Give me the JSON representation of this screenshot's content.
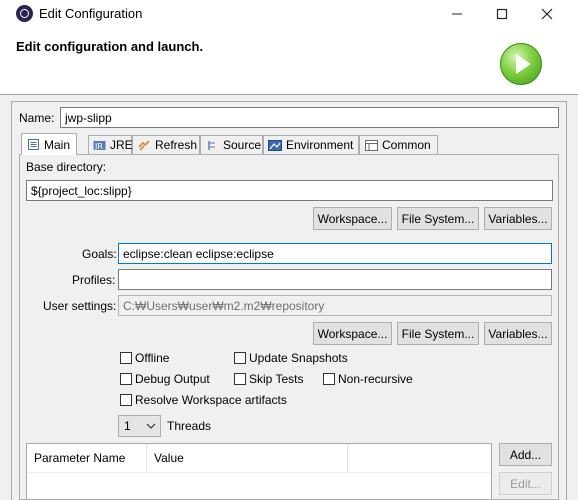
{
  "window": {
    "title": "Edit Configuration",
    "banner_title": "Edit configuration and launch."
  },
  "icons": {
    "app": "eclipse-icon",
    "run": "run-icon",
    "minimize": "minimize-icon",
    "maximize": "maximize-icon",
    "close": "close-icon"
  },
  "name": {
    "label": "Name:",
    "value": "jwp-slipp"
  },
  "tabs": [
    {
      "label": "Main",
      "icon": "main-tab-icon",
      "active": true
    },
    {
      "label": "JRE",
      "icon": "jre-icon"
    },
    {
      "label": "Refresh",
      "icon": "refresh-icon"
    },
    {
      "label": "Source",
      "icon": "source-icon"
    },
    {
      "label": "Environment",
      "icon": "environment-icon"
    },
    {
      "label": "Common",
      "icon": "common-icon"
    }
  ],
  "main": {
    "base_dir_label": "Base directory:",
    "base_dir_value": "${project_loc:slipp}",
    "buttons": {
      "workspace": "Workspace...",
      "file_system": "File System...",
      "variables": "Variables..."
    },
    "goals_label": "Goals:",
    "goals_value": "eclipse:clean eclipse:eclipse",
    "profiles_label": "Profiles:",
    "profiles_value": "",
    "user_settings_label": "User settings:",
    "user_settings_placeholder": "C:₩Users₩user₩m2.m2₩repository",
    "options": {
      "offline": "Offline",
      "update_snapshots": "Update Snapshots",
      "debug_output": "Debug Output",
      "skip_tests": "Skip Tests",
      "non_recursive": "Non-recursive",
      "resolve_workspace": "Resolve Workspace artifacts"
    },
    "threads_value": "1",
    "threads_label": "Threads",
    "table": {
      "columns": [
        "Parameter Name",
        "Value"
      ]
    },
    "add_button": "Add...",
    "edit_button": "Edit..."
  }
}
